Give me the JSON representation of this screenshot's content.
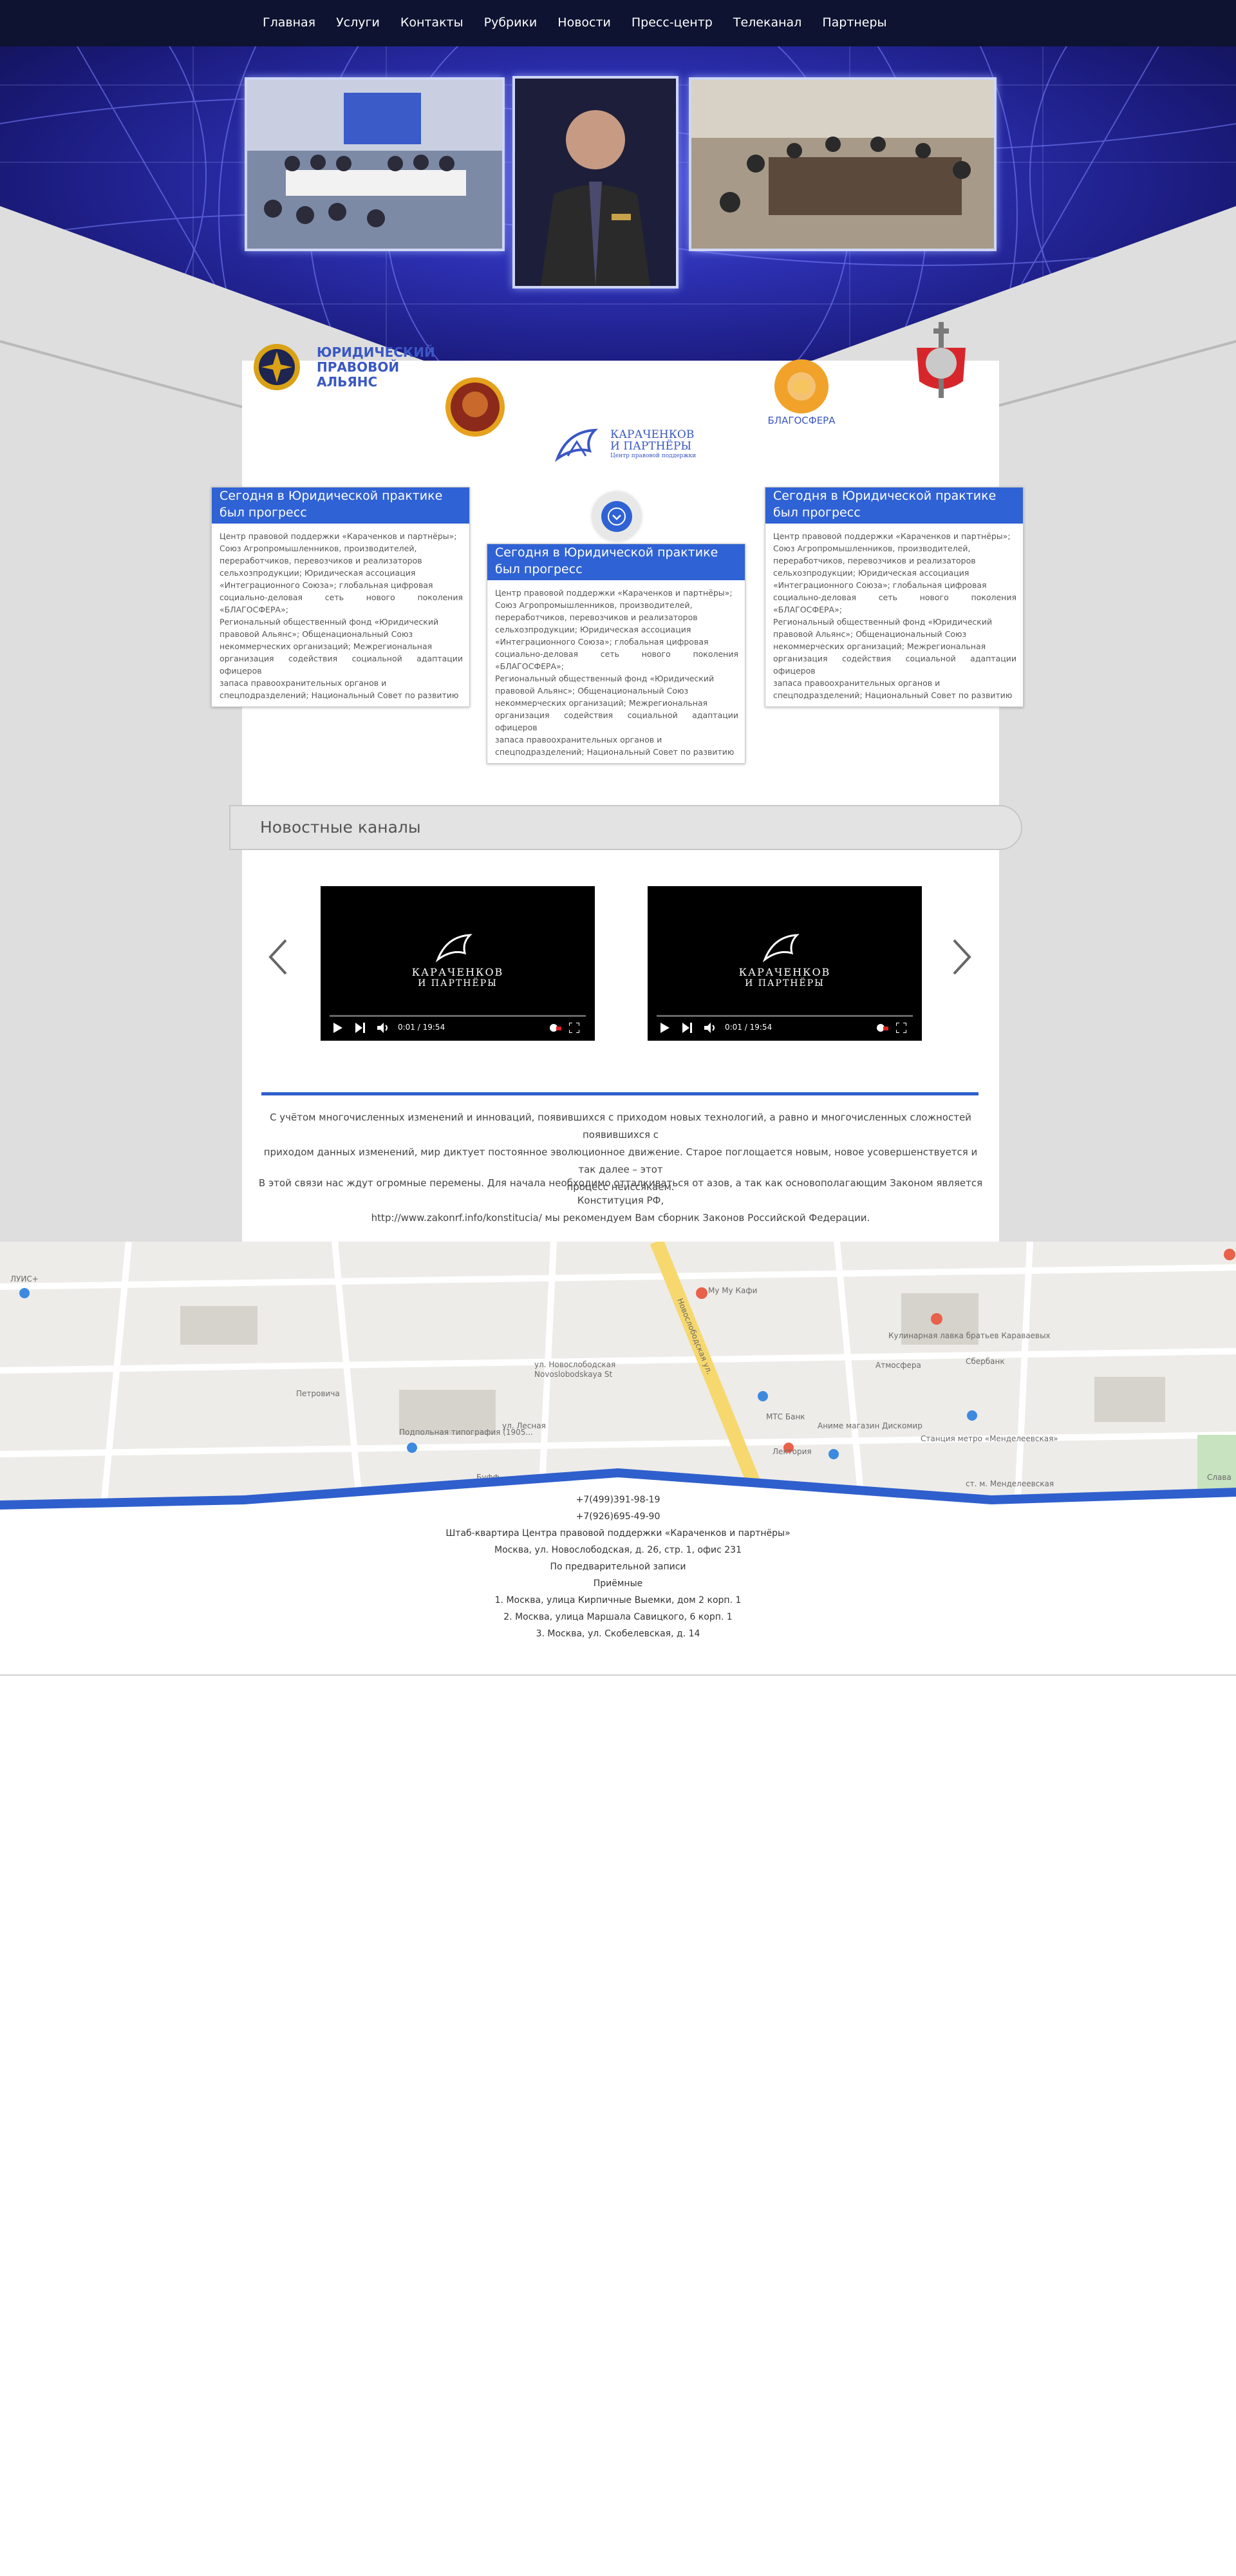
{
  "nav": {
    "items": [
      "Главная",
      "Услуги",
      "Контакты",
      "Рубрики",
      "Новости",
      "Пресс-центр",
      "Телеканал",
      "Партнеры"
    ]
  },
  "partners": {
    "alliance": "ЮРИДИЧЕСКИЙ\nПРАВОВОЙ\nАЛЬЯНС",
    "alliance_lines": [
      "ЮРИДИЧЕСКИЙ",
      "ПРАВОВОЙ",
      "АЛЬЯНС"
    ],
    "blagosfera": "БЛАГОСФЕРА",
    "karachenkov_line1": "КАРАЧЕНКОВ",
    "karachenkov_line2": "И ПАРТНЁРЫ",
    "karachenkov_sub": "Центр правовой поддержки"
  },
  "cards": {
    "title_lines": [
      "Сегодня в Юридической практике",
      "был прогресс"
    ],
    "body_lines": [
      "Центр правовой поддержки «Караченков и партнёры»;",
      "Союз Агропромышленников, производителей,",
      "переработчиков, перевозчиков и реализаторов",
      "сельхозпродукции; Юридическая ассоциация",
      "«Интеграционного Союза»; глобальная цифровая",
      "социально-деловая сеть нового поколения «БЛАГОСФЕРА»;",
      "Региональный общественный фонд «Юридический",
      "правовой Альянс»; Общенациональный Союз",
      "некоммерческих организаций; Межрегиональная",
      "организация содействия социальной адаптации офицеров",
      "запаса правоохранительных органов и",
      "спецподразделений; Национальный Совет по развитию"
    ]
  },
  "news": {
    "title": "Новостные каналы",
    "video_logo_line1": "КАРАЧЕНКОВ",
    "video_logo_line2": "И ПАРТНЁРЫ",
    "video_time": "0:01 / 19:54"
  },
  "text": {
    "para1_line1": "С учётом многочисленных изменений и инноваций, появившихся с приходом новых технологий, а равно и многочисленных сложностей появившихся с",
    "para1_line2": "приходом данных изменений, мир диктует постоянное эволюционное движение. Старое поглощается новым, новое усовершенствуется и так далее – этот",
    "para1_line3": "процесс неиссякаем.",
    "para2_line1": "В этой связи нас ждут огромные перемены. Для начала необходимо отталкиваться от азов, а так как основополагающим Законом является Конституция РФ,",
    "para2_line2": "http://www.zakonrf.info/konstitucia/ мы рекомендуем Вам сборник Законов Российской Федерации."
  },
  "map": {
    "labels": [
      "ЛУИС+",
      "Петровича",
      "Подпольная типография (1905...",
      "ул. Лесная",
      "Буфф",
      "ул. Новослободская",
      "Novoslobodskaya St",
      "My My Кафи",
      "Кулинарная лавка братьев Караваевых",
      "Атмосфера",
      "Сбербанк",
      "МТС Банк",
      "Аниме магазин Дискомир",
      "Лектория",
      "Станция метро «Менделеевская»",
      "ст. м. Менделеевская",
      "Слава",
      "Новослободская ул."
    ]
  },
  "footer": {
    "lines": [
      "+7(499)391-98-19",
      "+7(926)695-49-90",
      "Штаб-квартира Центра правовой поддержки «Караченков и партнёры»",
      "Москва, ул. Новослободская, д. 26, стр. 1, офис 231",
      "По предварительной записи",
      "Приёмные",
      "1.  Москва, улица Кирпичные Выемки, дом 2 корп. 1",
      "2. Москва, улица Маршала Савицкого, 6 корп. 1",
      "3. Москва, ул. Скобелевская, д. 14"
    ]
  },
  "colors": {
    "accent": "#2f62d4",
    "nav_bg": "#0d1330",
    "gray": "#dcdcdc"
  }
}
